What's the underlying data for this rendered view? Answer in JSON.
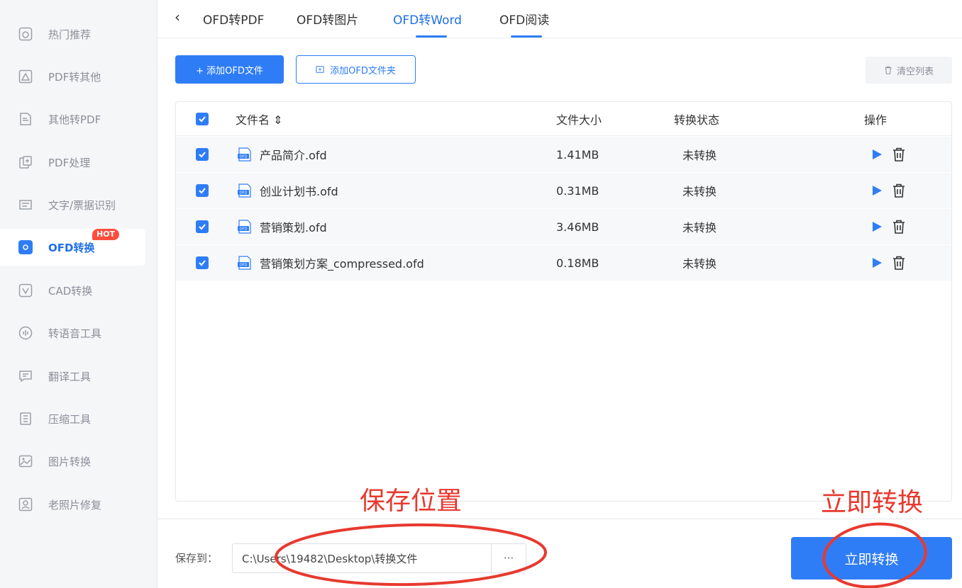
{
  "sidebar": {
    "items": [
      {
        "label": "热门推荐",
        "icon": "hot-recommend-icon"
      },
      {
        "label": "PDF转其他",
        "icon": "pdf-to-other-icon"
      },
      {
        "label": "其他转PDF",
        "icon": "other-to-pdf-icon"
      },
      {
        "label": "PDF处理",
        "icon": "pdf-process-icon"
      },
      {
        "label": "文字/票据识别",
        "icon": "ocr-icon"
      },
      {
        "label": "OFD转换",
        "icon": "ofd-convert-icon",
        "badge": "HOT",
        "active": true
      },
      {
        "label": "CAD转换",
        "icon": "cad-convert-icon"
      },
      {
        "label": "转语音工具",
        "icon": "voice-tool-icon"
      },
      {
        "label": "翻译工具",
        "icon": "translate-icon"
      },
      {
        "label": "压缩工具",
        "icon": "compress-icon"
      },
      {
        "label": "图片转换",
        "icon": "image-convert-icon"
      },
      {
        "label": "老照片修复",
        "icon": "photo-repair-icon"
      }
    ]
  },
  "tabs": [
    {
      "label": "OFD转PDF"
    },
    {
      "label": "OFD转图片"
    },
    {
      "label": "OFD转Word",
      "active": true
    },
    {
      "label": "OFD阅读"
    }
  ],
  "toolbar": {
    "add_file": "+ 添加OFD文件",
    "add_folder": "添加OFD文件夹",
    "clear_list": "清空列表"
  },
  "table": {
    "headers": {
      "name": "文件名 ⇕",
      "size": "文件大小",
      "status": "转换状态",
      "action": "操作"
    },
    "rows": [
      {
        "name": "产品简介.ofd",
        "size": "1.41MB",
        "status": "未转换",
        "checked": true
      },
      {
        "name": "创业计划书.ofd",
        "size": "0.31MB",
        "status": "未转换",
        "checked": true
      },
      {
        "name": "营销策划.ofd",
        "size": "3.46MB",
        "status": "未转换",
        "checked": true
      },
      {
        "name": "营销策划方案_compressed.ofd",
        "size": "0.18MB",
        "status": "未转换",
        "checked": true
      }
    ]
  },
  "annotations": {
    "save_location": "保存位置",
    "convert_now": "立即转换"
  },
  "footer": {
    "save_to_label": "保存到：",
    "save_path": "C:\\Users\\19482\\Desktop\\转换文件",
    "browse_label": "···",
    "convert_button": "立即转换"
  },
  "colors": {
    "accent": "#2f7df6",
    "annotation_red": "#e8392f",
    "hot_badge": "#ff4d3d"
  }
}
